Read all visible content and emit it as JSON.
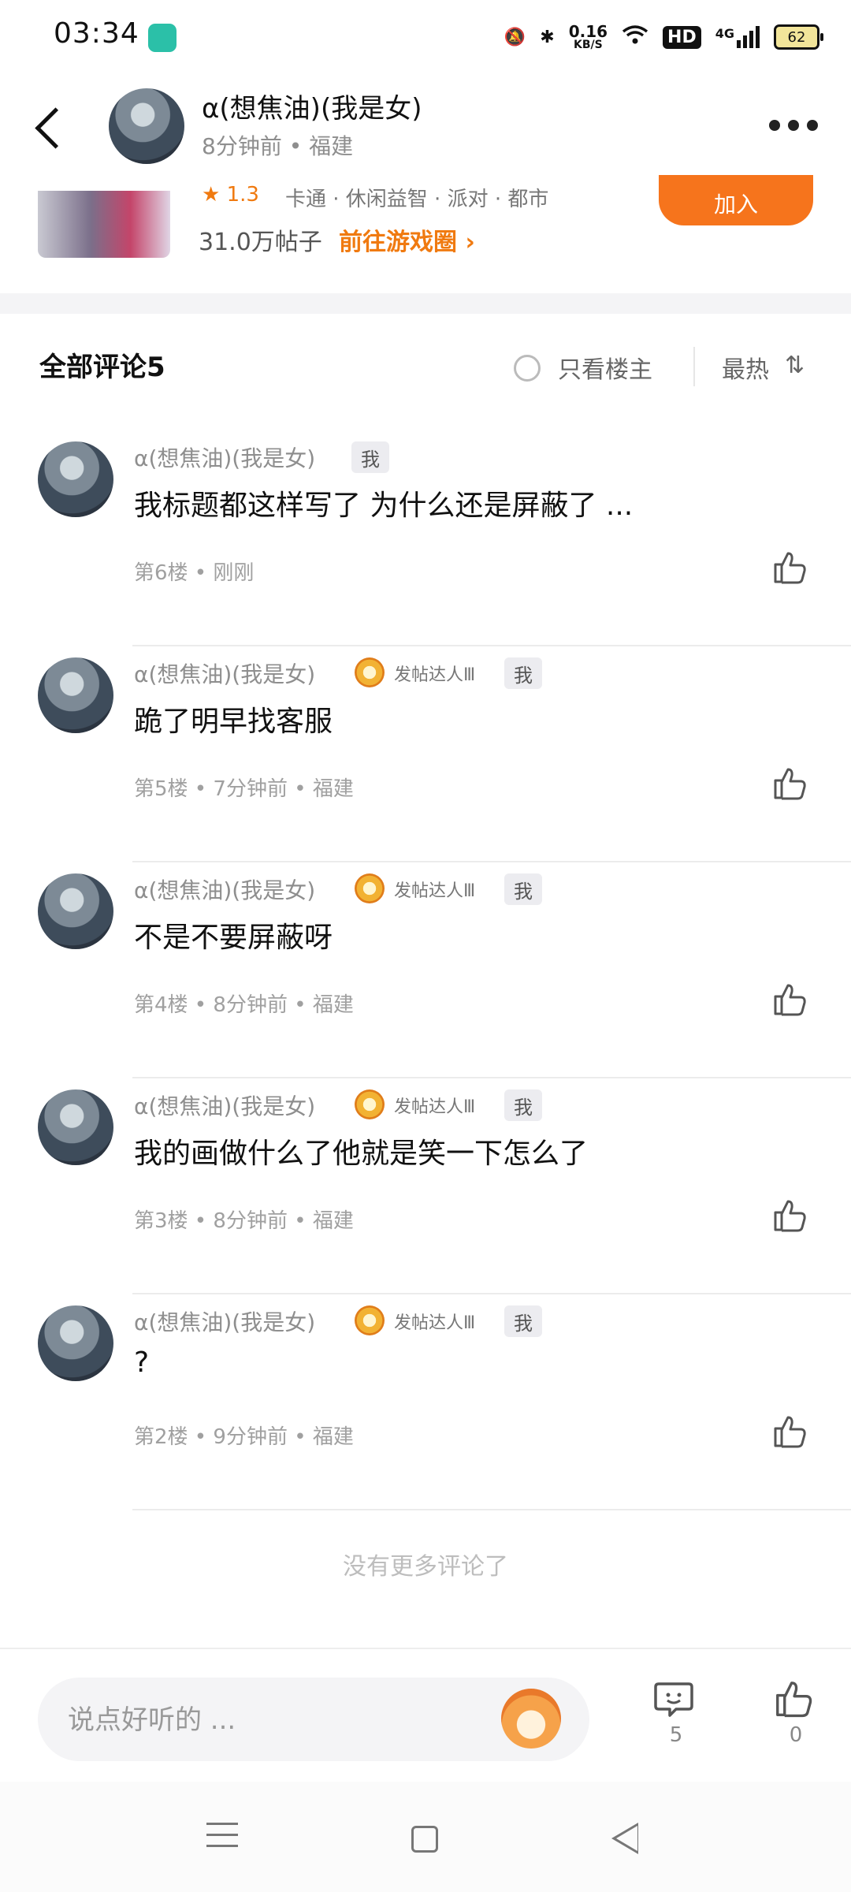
{
  "status_bar": {
    "time": "03:34",
    "net_speed_value": "0.16",
    "net_speed_unit": "KB/S",
    "hd": "HD",
    "network": "4G",
    "battery": "62"
  },
  "header": {
    "author_name": "α(想焦油)(我是女)",
    "author_meta": "8分钟前 • 福建"
  },
  "game_card": {
    "rating": "★ 1.3",
    "tags": "卡通 · 休闲益智 · 派对 · 都市",
    "post_count": "31.0万帖子",
    "goto_label": "前往游戏圈 ›",
    "join_label": "加入"
  },
  "comments_header": {
    "title": "全部评论5",
    "only_op_label": "只看楼主",
    "sort_label": "最热",
    "sort_icon": "⇅"
  },
  "comments": [
    {
      "name": "α(想焦油)(我是女)",
      "badge": "",
      "me": "我",
      "text": "我标题都这样写了 为什么还是屏蔽了 ...",
      "meta": "第6楼 • 刚刚"
    },
    {
      "name": "α(想焦油)(我是女)",
      "badge": "发帖达人Ⅲ",
      "me": "我",
      "text": "跪了明早找客服",
      "meta": "第5楼 • 7分钟前 • 福建"
    },
    {
      "name": "α(想焦油)(我是女)",
      "badge": "发帖达人Ⅲ",
      "me": "我",
      "text": "不是不要屏蔽呀",
      "meta": "第4楼 • 8分钟前 • 福建"
    },
    {
      "name": "α(想焦油)(我是女)",
      "badge": "发帖达人Ⅲ",
      "me": "我",
      "text": "我的画做什么了他就是笑一下怎么了",
      "meta": "第3楼 • 8分钟前 • 福建"
    },
    {
      "name": "α(想焦油)(我是女)",
      "badge": "发帖达人Ⅲ",
      "me": "我",
      "text": "?",
      "meta": "第2楼 • 9分钟前 • 福建"
    }
  ],
  "no_more_label": "没有更多评论了",
  "bottom_bar": {
    "input_placeholder": "说点好听的 ...",
    "comment_count": "5",
    "like_count": "0"
  },
  "colors": {
    "accent_orange": "#f6741c",
    "text_gray": "#8e8e8e"
  },
  "icons": [
    "back-arrow-icon",
    "more-icon",
    "star-icon",
    "radio-icon",
    "sort-icon",
    "thumbs-up-icon",
    "comment-bubble-icon",
    "mascot-icon",
    "nav-menu-icon",
    "nav-home-icon",
    "nav-back-icon"
  ]
}
